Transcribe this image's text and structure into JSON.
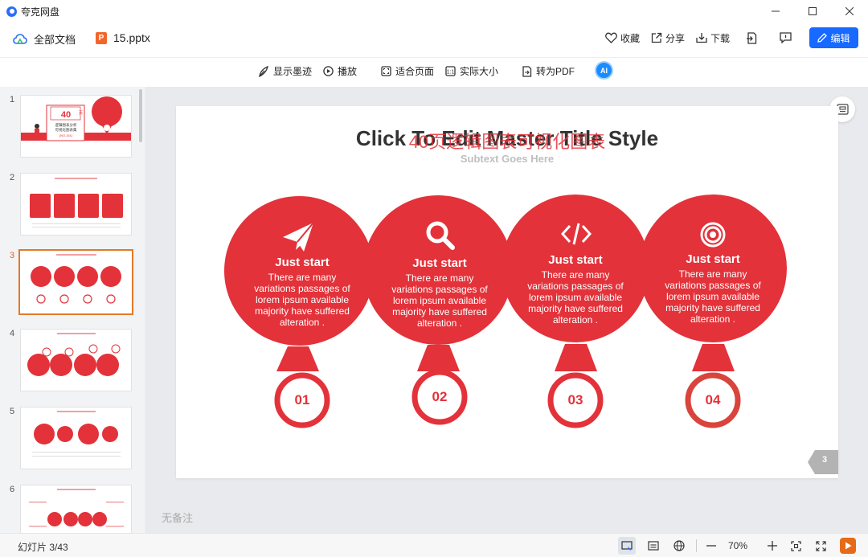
{
  "app": {
    "name": "夸克网盘"
  },
  "header": {
    "all_docs": "全部文档",
    "file_name": "15.pptx",
    "file_badge": "P",
    "actions": {
      "favorite": "收藏",
      "share": "分享",
      "download": "下载"
    },
    "edit": "编辑"
  },
  "toolbar": {
    "show_ink": "显示墨迹",
    "play": "播放",
    "fit_page": "适合页面",
    "actual_size": "实际大小",
    "to_pdf": "转为PDF",
    "ai": "AI"
  },
  "sidebar": {
    "thumbnails": [
      {
        "num": "1"
      },
      {
        "num": "2"
      },
      {
        "num": "3",
        "active": true
      },
      {
        "num": "4"
      },
      {
        "num": "5"
      },
      {
        "num": "6"
      }
    ],
    "slide1": {
      "big": "40",
      "small_suffix": "页",
      "line1": "逻辑图表分析",
      "line2": "可视化图表集",
      "line3": "(NO.151)"
    }
  },
  "slide": {
    "title": "Click To Edit Master Title Style",
    "overlay_title": "40页逻辑图表可视化图表",
    "subtitle": "Subtext Goes Here",
    "items": [
      {
        "icon": "paper-plane-icon",
        "heading": "Just start",
        "lines": [
          "There are many",
          "variations passages of",
          "lorem ipsum available",
          "majority have suffered",
          "alteration ."
        ],
        "number": "01"
      },
      {
        "icon": "search-icon",
        "heading": "Just start",
        "lines": [
          "There are many",
          "variations passages of",
          "lorem ipsum available",
          "majority have suffered",
          "alteration ."
        ],
        "number": "02"
      },
      {
        "icon": "code-icon",
        "heading": "Just start",
        "lines": [
          "There are many",
          "variations passages of",
          "lorem ipsum available",
          "majority have suffered",
          "alteration ."
        ],
        "number": "03"
      },
      {
        "icon": "target-icon",
        "heading": "Just start",
        "lines": [
          "There are many",
          "variations passages of",
          "lorem ipsum available",
          "majority have suffered",
          "alteration ."
        ],
        "number": "04"
      }
    ],
    "page_number": "3",
    "accent": "#e3323a"
  },
  "notes": "无备注",
  "status": {
    "slide_counter": "幻灯片 3/43",
    "zoom": "70%"
  },
  "colors": {
    "primary": "#1769ff",
    "accent": "#e3323a",
    "play": "#e66a17"
  }
}
